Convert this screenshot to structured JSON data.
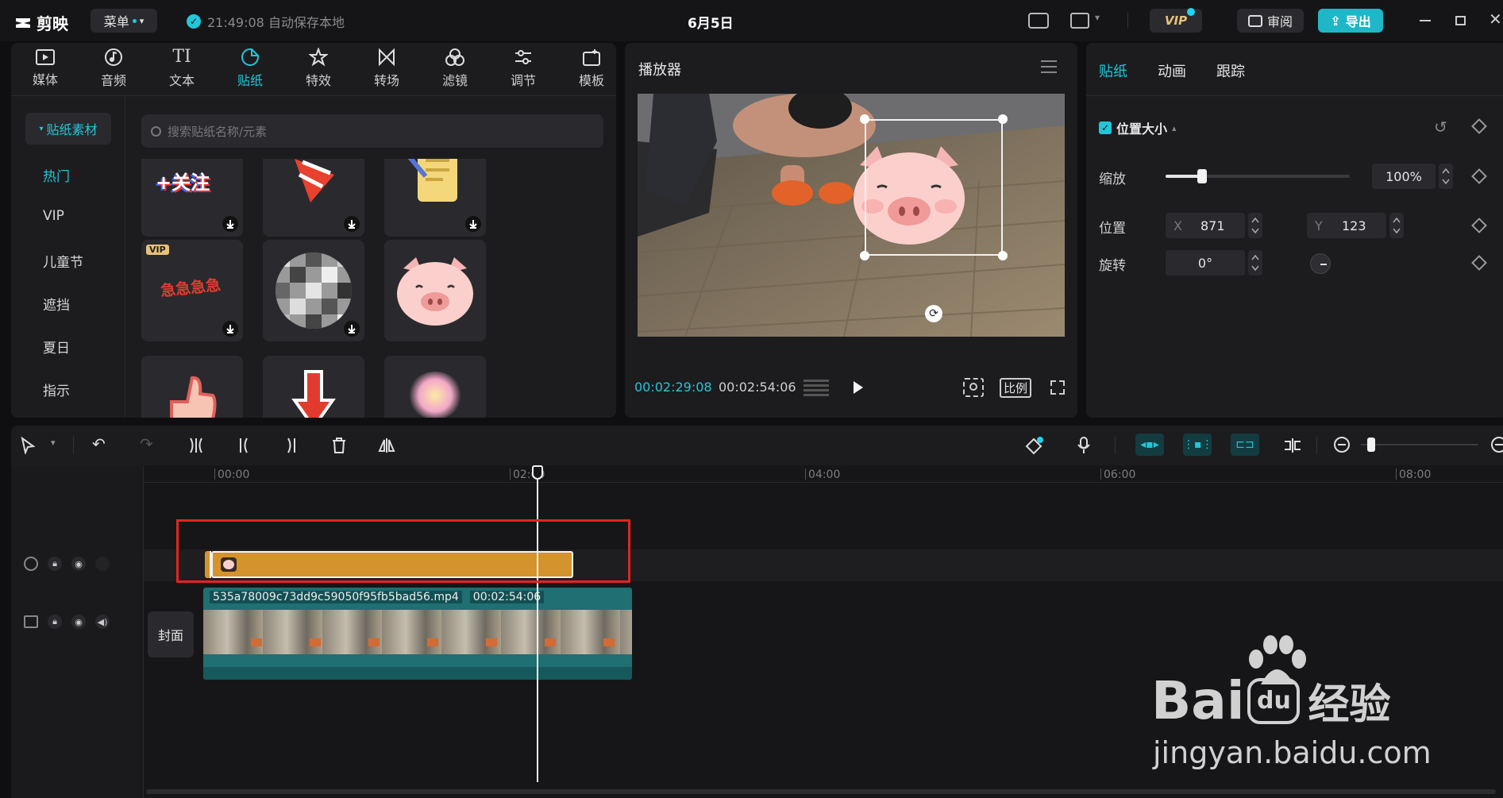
{
  "app": {
    "logo_text": "剪映",
    "menu_label": "菜单",
    "save_status": "21:49:08 自动保存本地",
    "project_title": "6月5日",
    "vip_label": "VIP",
    "review_label": "审阅",
    "export_label": "导出"
  },
  "media_tabs": [
    {
      "label": "媒体",
      "icon": "media-icon"
    },
    {
      "label": "音频",
      "icon": "audio-icon"
    },
    {
      "label": "文本",
      "icon": "text-icon"
    },
    {
      "label": "贴纸",
      "icon": "sticker-icon",
      "active": true
    },
    {
      "label": "特效",
      "icon": "effects-icon"
    },
    {
      "label": "转场",
      "icon": "transition-icon"
    },
    {
      "label": "滤镜",
      "icon": "filter-icon"
    },
    {
      "label": "调节",
      "icon": "adjust-icon"
    },
    {
      "label": "模板",
      "icon": "template-icon"
    }
  ],
  "sticker_panel": {
    "category": "贴纸素材",
    "items": [
      "热门",
      "VIP",
      "儿童节",
      "遮挡",
      "夏日",
      "指示"
    ],
    "active_item": "热门",
    "search_placeholder": "搜索贴纸名称/元素",
    "stickers": [
      {
        "name": "follow-sticker",
        "text": "+关注"
      },
      {
        "name": "party-cone-sticker"
      },
      {
        "name": "notepad-sticker"
      },
      {
        "name": "vip-urgent-sticker",
        "badge": "VIP",
        "text": "急急急急"
      },
      {
        "name": "mosaic-sticker"
      },
      {
        "name": "pig-face-sticker"
      },
      {
        "name": "thumbs-up-sticker"
      },
      {
        "name": "red-arrow-sticker"
      },
      {
        "name": "glow-heart-sticker"
      }
    ]
  },
  "player": {
    "title": "播放器",
    "current_time": "00:02:29:08",
    "total_time": "00:02:54:06",
    "ratio_label": "比例"
  },
  "properties": {
    "tabs": [
      "贴纸",
      "动画",
      "跟踪"
    ],
    "active_tab": "贴纸",
    "section_title": "位置大小",
    "scale_label": "缩放",
    "scale_value": "100%",
    "scale_level": 0.2,
    "position_label": "位置",
    "pos_x_label": "X",
    "pos_x": "871",
    "pos_y_label": "Y",
    "pos_y": "123",
    "rotation_label": "旋转",
    "rotation_value": "0°"
  },
  "timeline": {
    "ruler_ticks": [
      "00:00",
      "02:00",
      "04:00",
      "06:00",
      "08:00"
    ],
    "video_clip_name": "535a78009c73dd9c59050f95fb5bad56.mp4",
    "video_clip_duration": "00:02:54:06",
    "cover_label": "封面"
  },
  "watermark": {
    "brand": "Bai",
    "brand_suffix": "经验",
    "url": "jingyan.baidu.com"
  },
  "colors": {
    "accent": "#22c6d8",
    "sticker_clip": "#d4932c",
    "video_clip": "#1f6f73",
    "highlight_box": "#e32420"
  }
}
